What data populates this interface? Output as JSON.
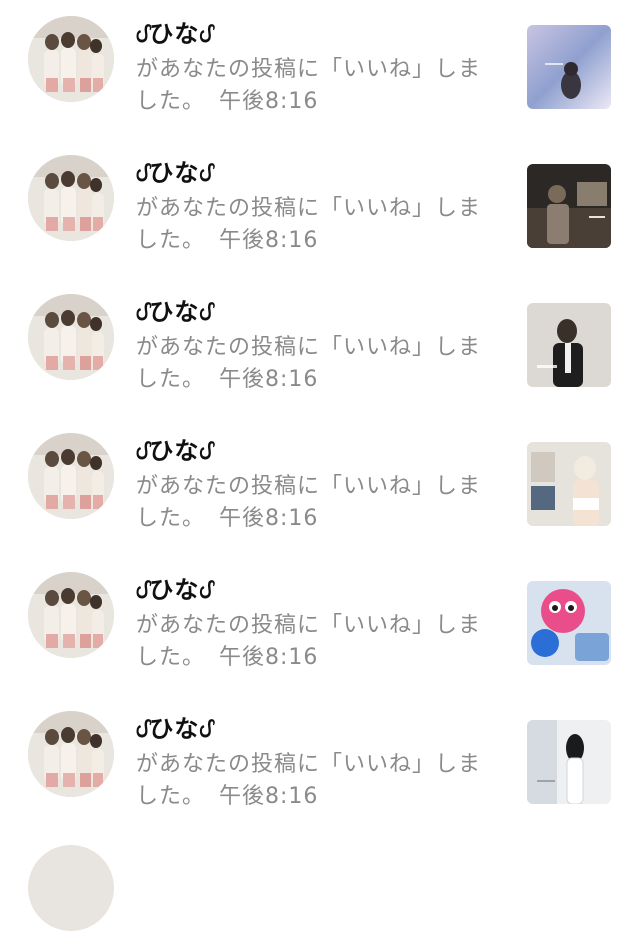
{
  "notifications": [
    {
      "username": "ᦔひなᦔ",
      "message": "があなたの投稿に「いいね」しました。",
      "time": "午後8:16",
      "avatar_icon": "user-photo-avatar",
      "thumb_icon": "post-thumbnail",
      "thumb_colors": [
        "#b9b3d6",
        "#8f9cc9",
        "#e9e6f2"
      ]
    },
    {
      "username": "ᦔひなᦔ",
      "message": "があなたの投稿に「いいね」しました。",
      "time": "午後8:16",
      "avatar_icon": "user-photo-avatar",
      "thumb_icon": "post-thumbnail",
      "thumb_colors": [
        "#2c2a2a",
        "#6b5a4b",
        "#c9b79a"
      ]
    },
    {
      "username": "ᦔひなᦔ",
      "message": "があなたの投稿に「いいね」しました。",
      "time": "午後8:16",
      "avatar_icon": "user-photo-avatar",
      "thumb_icon": "post-thumbnail",
      "thumb_colors": [
        "#d9d5d0",
        "#1d1d1d",
        "#f3f0ed"
      ]
    },
    {
      "username": "ᦔひなᦔ",
      "message": "があなたの投稿に「いいね」しました。",
      "time": "午後8:16",
      "avatar_icon": "user-photo-avatar",
      "thumb_icon": "post-thumbnail",
      "thumb_colors": [
        "#e7e4de",
        "#f4e4d4",
        "#4a4a4a"
      ]
    },
    {
      "username": "ᦔひなᦔ",
      "message": "があなたの投稿に「いいね」しました。",
      "time": "午後8:16",
      "avatar_icon": "user-photo-avatar",
      "thumb_icon": "post-thumbnail",
      "thumb_colors": [
        "#2b6fd6",
        "#e94e8a",
        "#d9e4f2"
      ]
    },
    {
      "username": "ᦔひなᦔ",
      "message": "があなたの投稿に「いいね」しました。",
      "time": "午後8:16",
      "avatar_icon": "user-photo-avatar",
      "thumb_icon": "post-thumbnail",
      "thumb_colors": [
        "#eef0f2",
        "#cfd6dc",
        "#1b1b1b"
      ]
    }
  ]
}
